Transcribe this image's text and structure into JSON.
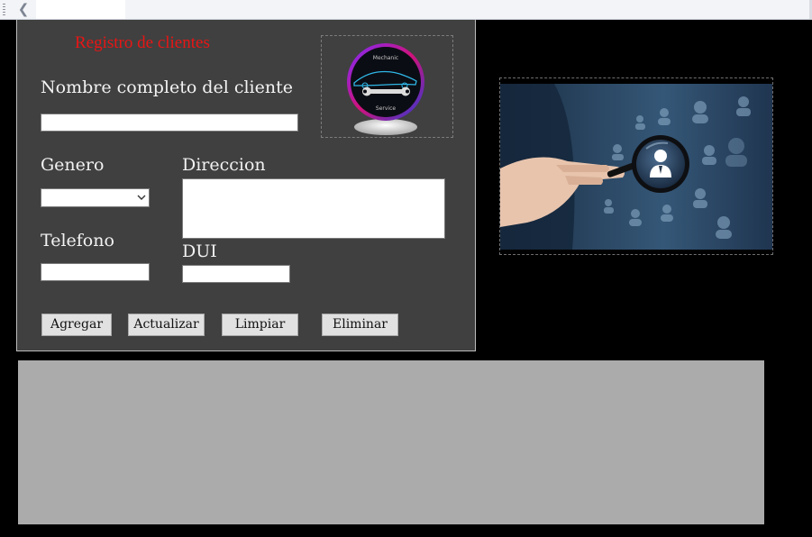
{
  "window": {
    "back_glyph": "❮"
  },
  "form": {
    "title": "Registro de clientes",
    "nombre_label": "Nombre completo del cliente",
    "nombre_value": "",
    "genero_label": "Genero",
    "genero_value": "",
    "direccion_label": "Direccion",
    "direccion_value": "",
    "telefono_label": "Telefono",
    "telefono_value": "",
    "dui_label": "DUI",
    "dui_value": ""
  },
  "logo": {
    "top_text": "Mechanic",
    "bottom_text": "Service"
  },
  "buttons": {
    "agregar": "Agregar",
    "actualizar": "Actualizar",
    "limpiar": "Limpiar",
    "eliminar": "Eliminar"
  },
  "colors": {
    "title_red": "#e81515",
    "panel_bg": "#404040",
    "grid_bg": "#ababab"
  }
}
